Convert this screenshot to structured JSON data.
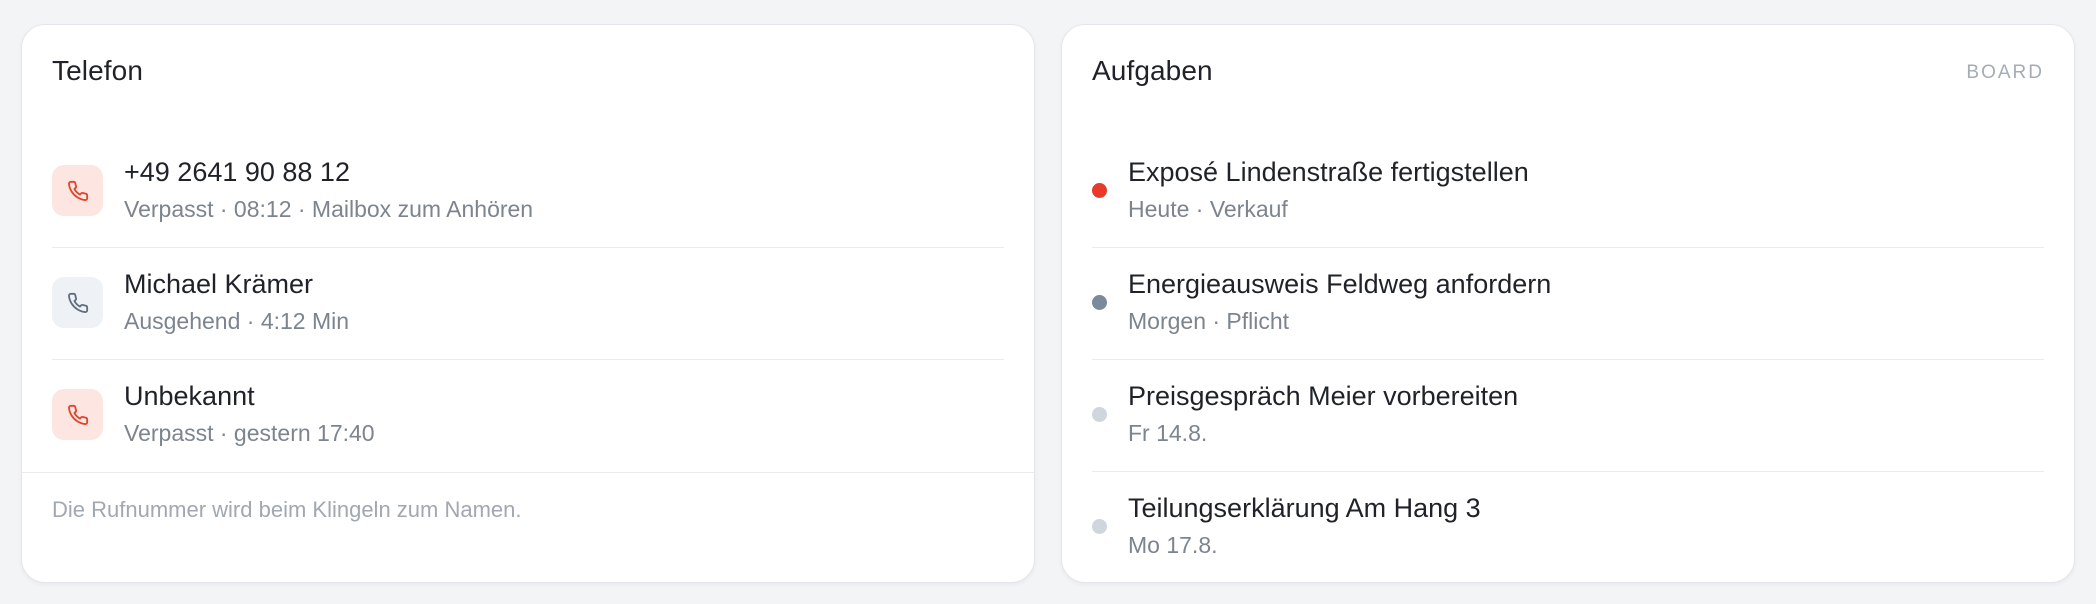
{
  "phone_card": {
    "title": "Telefon",
    "calls": [
      {
        "title": "+49 2641 90 88 12",
        "subtitle": "Verpasst · 08:12 · Mailbox zum Anhören",
        "type": "missed",
        "icon": "phone-icon"
      },
      {
        "title": "Michael Krämer",
        "subtitle": "Ausgehend · 4:12 Min",
        "type": "outgoing",
        "icon": "phone-icon"
      },
      {
        "title": "Unbekannt",
        "subtitle": "Verpasst · gestern 17:40",
        "type": "missed",
        "icon": "phone-icon"
      }
    ],
    "footer": "Die Rufnummer wird beim Klingeln zum Namen."
  },
  "tasks_card": {
    "title": "Aufgaben",
    "action_label": "BOARD",
    "tasks": [
      {
        "title": "Exposé Lindenstraße fertigstellen",
        "subtitle": "Heute · Verkauf",
        "dot_color": "#e8392a"
      },
      {
        "title": "Energieausweis Feldweg anfordern",
        "subtitle": "Morgen · Pflicht",
        "dot_color": "#7a8a9a"
      },
      {
        "title": "Preisgespräch Meier vorbereiten",
        "subtitle": "Fr 14.8.",
        "dot_color": "#cfd6de"
      },
      {
        "title": "Teilungserklärung Am Hang 3",
        "subtitle": "Mo 17.8.",
        "dot_color": "#cfd6de"
      }
    ]
  },
  "colors": {
    "missed_icon": "#e0462d",
    "missed_bg": "#fde6e2",
    "outgoing_icon": "#5f6f80",
    "outgoing_bg": "#eef1f5"
  }
}
